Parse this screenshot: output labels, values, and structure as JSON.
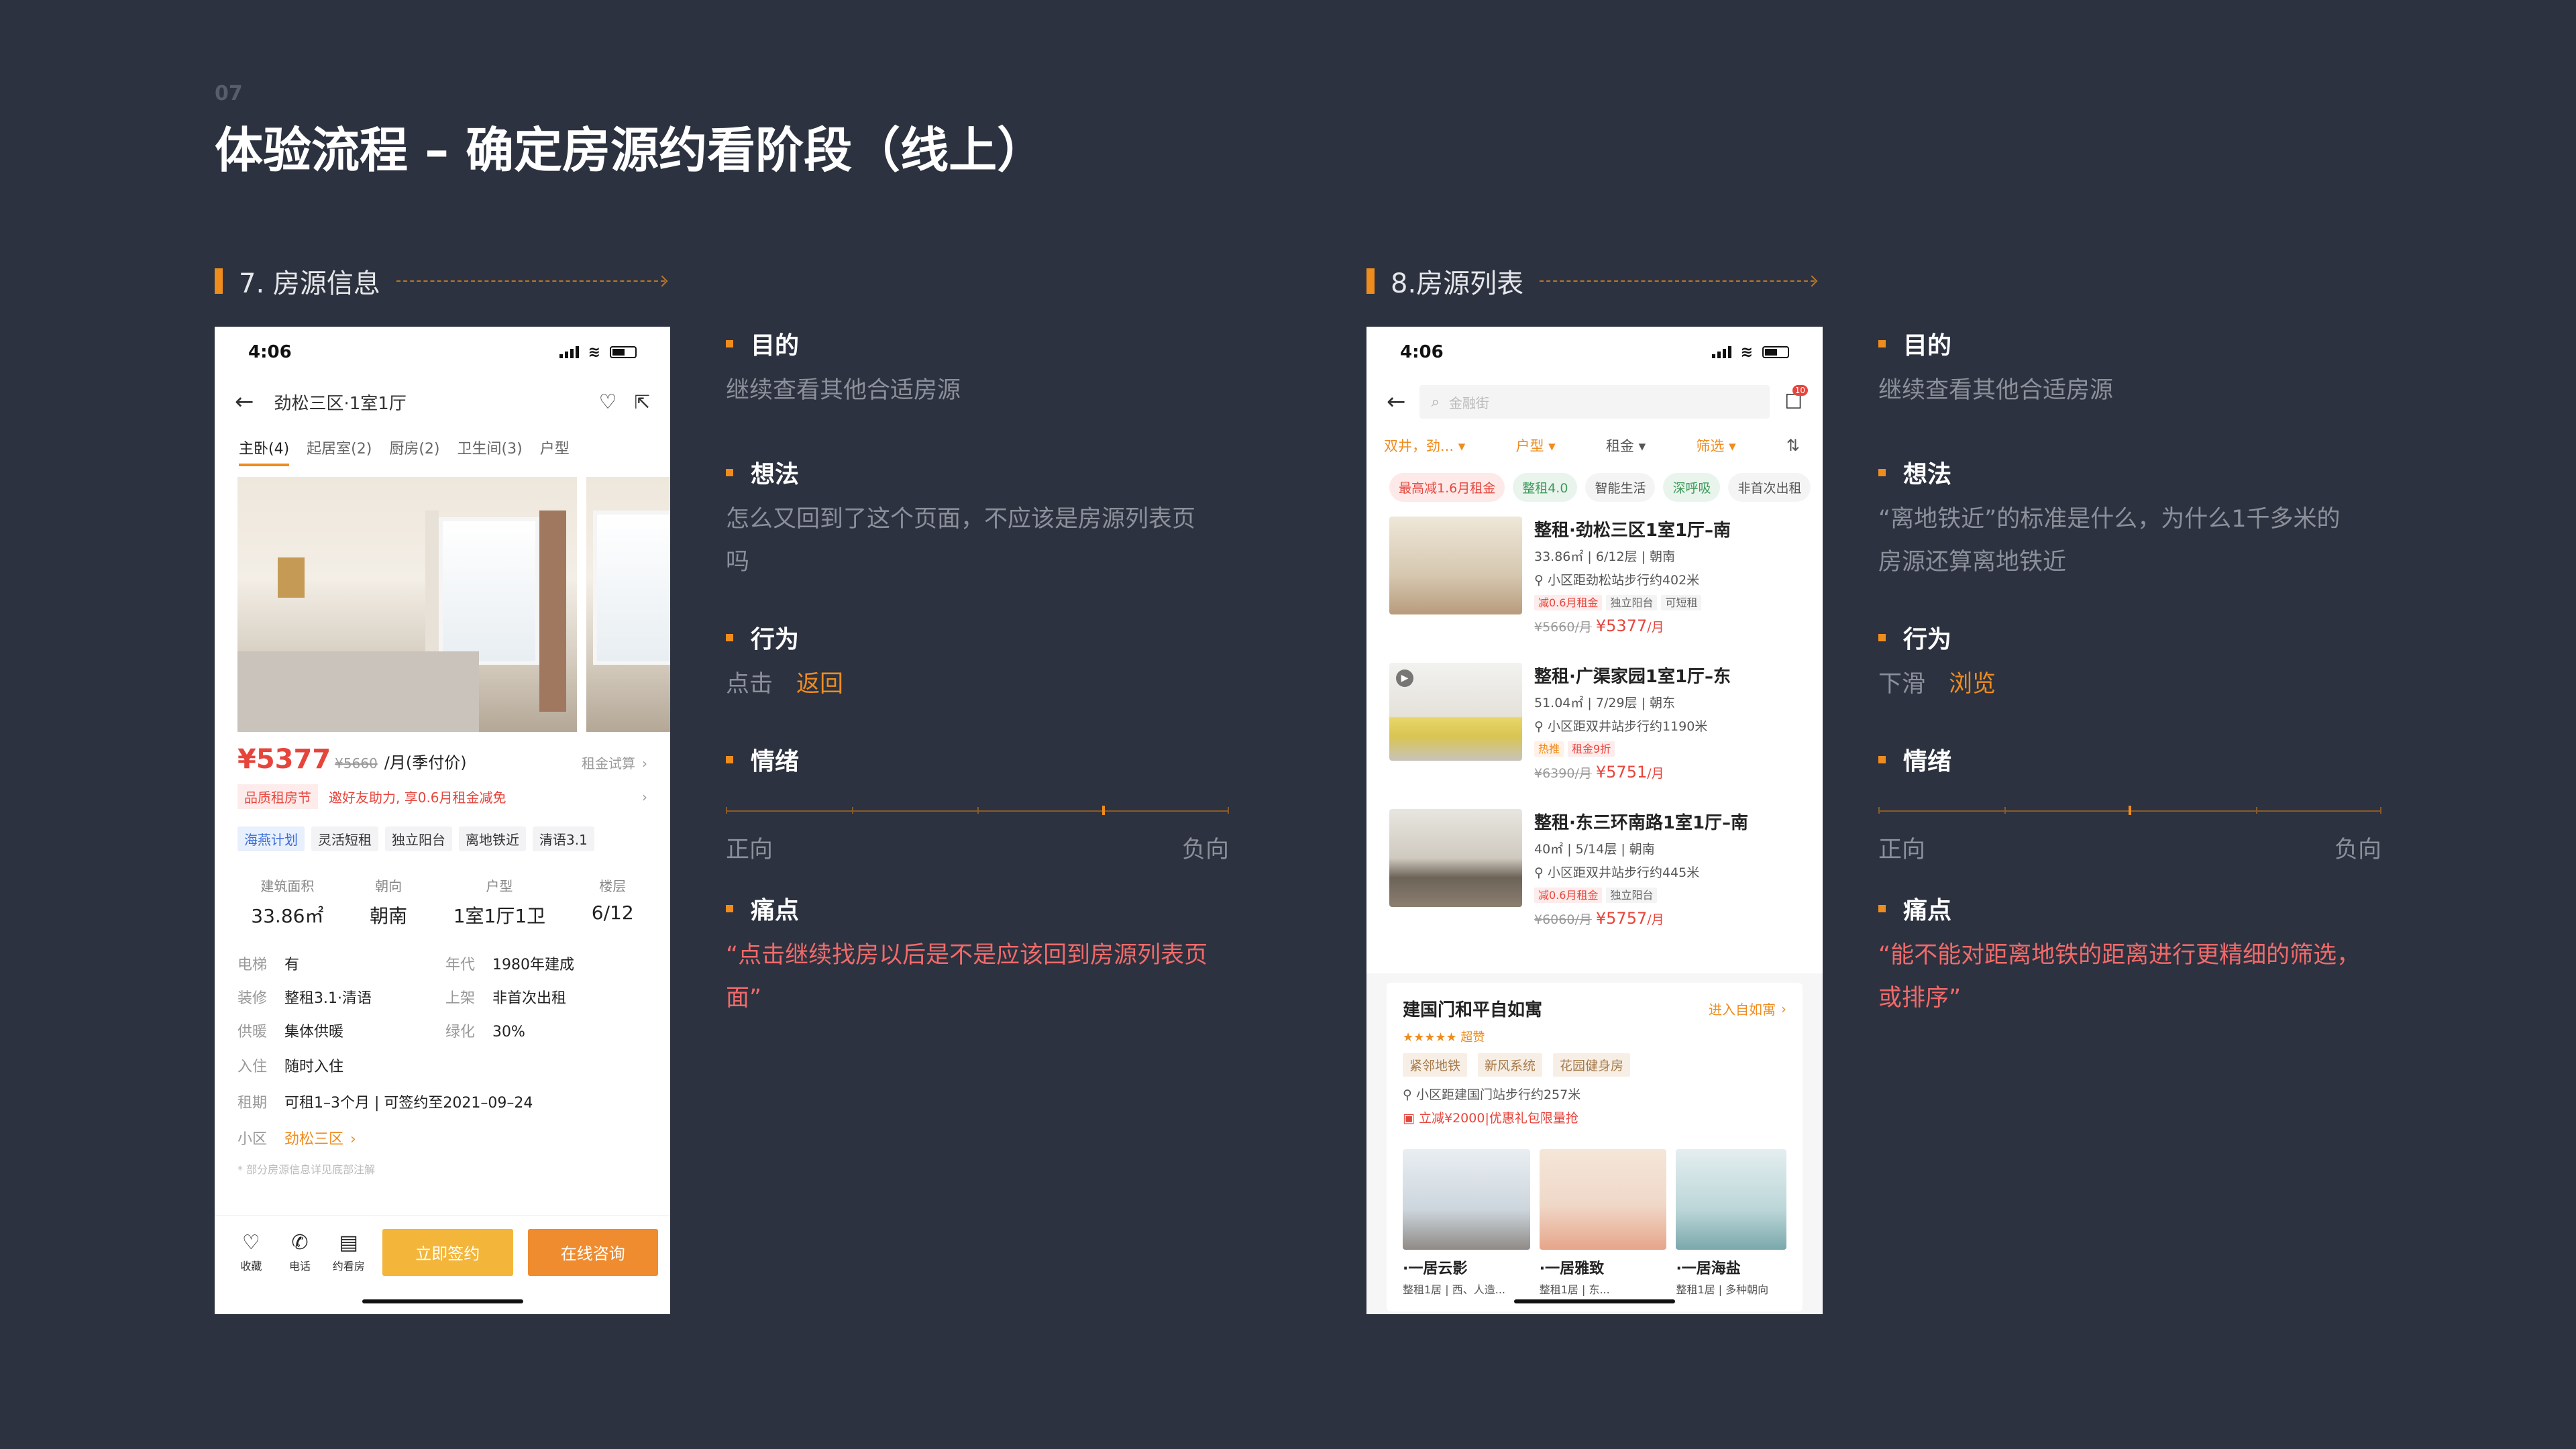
{
  "page_number": "07",
  "page_title": "体验流程 – 确定房源约看阶段（线上）",
  "sections": [
    {
      "title": "7. 房源信息",
      "purpose_label": "目的",
      "purpose": "继续查看其他合适房源",
      "thought_label": "想法",
      "thought": "怎么又回到了这个页面，不应该是房源列表页吗",
      "action_label": "行为",
      "action_prefix": "点击",
      "action_highlight": "返回",
      "emotion_label": "情绪",
      "emotion_left": "正向",
      "emotion_right": "负向",
      "emotion_level": 0.75,
      "pain_label": "痛点",
      "pain": "“点击继续找房以后是不是应该回到房源列表页面”"
    },
    {
      "title": "8.房源列表",
      "purpose_label": "目的",
      "purpose": "继续查看其他合适房源",
      "thought_label": "想法",
      "thought": "“离地铁近”的标准是什么，为什么1千多米的房源还算离地铁近",
      "action_label": "行为",
      "action_prefix": "下滑",
      "action_highlight": "浏览",
      "emotion_label": "情绪",
      "emotion_left": "正向",
      "emotion_right": "负向",
      "emotion_level": 0.5,
      "pain_label": "痛点",
      "pain": "“能不能对距离地铁的距离进行更精细的筛选，或排序”"
    }
  ],
  "phone1": {
    "time": "4:06",
    "nav_title": "劲松三区·1室1厅",
    "tabs": [
      "主卧(4)",
      "起居室(2)",
      "厨房(2)",
      "卫生间(3)",
      "户型"
    ],
    "price": "¥5377",
    "price_old": "¥5660",
    "price_unit": "/月(季付价)",
    "price_link": "租金试算",
    "promo_tag": "品质租房节",
    "promo_text": "邀好友助力, 享0.6月租金减免",
    "tags": [
      "海燕计划",
      "灵活短租",
      "独立阳台",
      "离地铁近",
      "清语3.1"
    ],
    "stats": [
      {
        "k": "建筑面积",
        "v": "33.86㎡"
      },
      {
        "k": "朝向",
        "v": "朝南"
      },
      {
        "k": "户型",
        "v": "1室1厅1卫"
      },
      {
        "k": "楼层",
        "v": "6/12"
      }
    ],
    "details": [
      {
        "k": "电梯",
        "v": "有",
        "k2": "年代",
        "v2": "1980年建成"
      },
      {
        "k": "装修",
        "v": "整租3.1·清语",
        "k2": "上架",
        "v2": "非首次出租"
      },
      {
        "k": "供暖",
        "v": "集体供暖",
        "k2": "绿化",
        "v2": "30%"
      }
    ],
    "checkin_k": "入住",
    "checkin_v": "随时入住",
    "term_k": "租期",
    "term_v": "可租1–3个月 | 可签约至2021–09–24",
    "community_k": "小区",
    "community_v": "劲松三区",
    "footnote": "* 部分房源信息详见底部注解",
    "icons": [
      "收藏",
      "电话",
      "约看房"
    ],
    "btn_sign": "立即签约",
    "btn_consult": "在线咨询"
  },
  "phone2": {
    "time": "4:06",
    "search_placeholder": "金融街",
    "badge": "10",
    "filters": [
      "双井，劲...",
      "户型",
      "租金",
      "筛选"
    ],
    "chips": [
      "最高减1.6月租金",
      "整租4.0",
      "智能生活",
      "深呼吸",
      "非首次出租"
    ],
    "listings": [
      {
        "title": "整租·劲松三区1室1厅–南",
        "meta": "33.86㎡ | 6/12层 | 朝南",
        "loc": "小区距劲松站步行约402米",
        "tags": [
          "减0.6月租金",
          "独立阳台",
          "可短租"
        ],
        "old": "¥5660/月",
        "price": "¥5377",
        "unit": "/月"
      },
      {
        "title": "整租·广渠家园1室1厅–东",
        "meta": "51.04㎡ | 7/29层 | 朝东",
        "loc": "小区距双井站步行约1190米",
        "tags": [
          "热推",
          "租金9折"
        ],
        "old": "¥6390/月",
        "price": "¥5751",
        "unit": "/月"
      },
      {
        "title": "整租·东三环南路1室1厅–南",
        "meta": "40㎡ | 5/14层 | 朝南",
        "loc": "小区距双井站步行约445米",
        "tags": [
          "减0.6月租金",
          "独立阳台"
        ],
        "old": "¥6060/月",
        "price": "¥5757",
        "unit": "/月"
      }
    ],
    "apt_name": "建国门和平自如寓",
    "apt_link": "进入自如寓",
    "apt_stars": "★★★★★",
    "apt_rating": "超赞",
    "apt_tags": [
      "紧邻地铁",
      "新风系统",
      "花园健身房"
    ],
    "apt_loc": "小区距建国门站步行约257米",
    "apt_promo": "立减¥2000|优惠礼包限量抢",
    "rooms": [
      {
        "name": "·一居云影",
        "desc": "整租1居 | 西、人造..."
      },
      {
        "name": "·一居雅致",
        "desc": "整租1居 | 东..."
      },
      {
        "name": "·一居海盐",
        "desc": "整租1居 | 多种朝向"
      }
    ]
  }
}
